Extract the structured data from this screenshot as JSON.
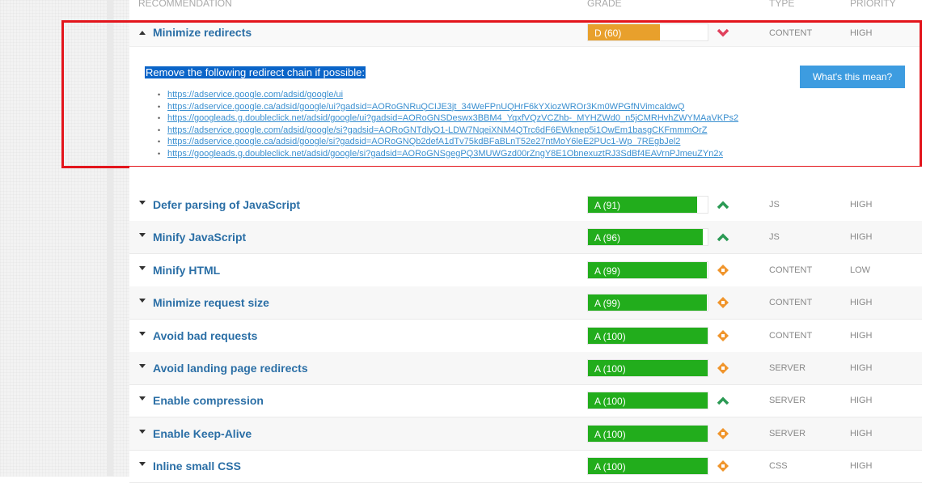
{
  "header": {
    "recommendation": "RECOMMENDATION",
    "grade": "GRADE",
    "type": "TYPE",
    "priority": "PRIORITY"
  },
  "expanded": {
    "name": "Minimize redirects",
    "grade_label": "D (60)",
    "grade_value": 60,
    "grade_color": "#e8a02c",
    "trend_icon": "chevron-down-icon",
    "trend_color": "#e0415c",
    "type": "CONTENT",
    "priority": "HIGH",
    "message": "Remove the following redirect chain if possible:",
    "button": "What's this mean?",
    "urls": [
      "https://adservice.google.com/adsid/google/ui",
      "https://adservice.google.ca/adsid/google/ui?gadsid=AORoGNRuQCIJE3jt_34WeFPnUQHrF6kYXiozWROr3Km0WPGfNVimcaldwQ",
      "https://googleads.g.doubleclick.net/adsid/google/ui?gadsid=AORoGNSDeswx3BBM4_YqxfVQzVCZhb-_MYHZWd0_n5jCMRHvhZWYMAaVKPs2",
      "https://adservice.google.com/adsid/google/si?gadsid=AORoGNTdlyO1-LDW7NqeiXNM4QTrc6dF6EWknep5i1OwEm1basgCKFmmmOrZ",
      "https://adservice.google.ca/adsid/google/si?gadsid=AORoGNQb2defA1dTv75kdBFaBLnT52e27ntMoY6leE2PUc1-Wp_7REgbJel2",
      "https://googleads.g.doubleclick.net/adsid/google/si?gadsid=AORoGNSgegPQ3MUWGzd00rZngY8E1ObnexuztRJ3SdBf4EAVrnPJmeuZYn2x"
    ]
  },
  "rows": [
    {
      "name": "Defer parsing of JavaScript",
      "grade_label": "A (91)",
      "grade_value": 91,
      "trend": "up",
      "type": "JS",
      "priority": "HIGH"
    },
    {
      "name": "Minify JavaScript",
      "grade_label": "A (96)",
      "grade_value": 96,
      "trend": "up",
      "type": "JS",
      "priority": "HIGH"
    },
    {
      "name": "Minify HTML",
      "grade_label": "A (99)",
      "grade_value": 99,
      "trend": "diamond",
      "type": "CONTENT",
      "priority": "LOW"
    },
    {
      "name": "Minimize request size",
      "grade_label": "A (99)",
      "grade_value": 99,
      "trend": "diamond",
      "type": "CONTENT",
      "priority": "HIGH"
    },
    {
      "name": "Avoid bad requests",
      "grade_label": "A (100)",
      "grade_value": 100,
      "trend": "diamond",
      "type": "CONTENT",
      "priority": "HIGH"
    },
    {
      "name": "Avoid landing page redirects",
      "grade_label": "A (100)",
      "grade_value": 100,
      "trend": "diamond",
      "type": "SERVER",
      "priority": "HIGH"
    },
    {
      "name": "Enable compression",
      "grade_label": "A (100)",
      "grade_value": 100,
      "trend": "up",
      "type": "SERVER",
      "priority": "HIGH"
    },
    {
      "name": "Enable Keep-Alive",
      "grade_label": "A (100)",
      "grade_value": 100,
      "trend": "diamond",
      "type": "SERVER",
      "priority": "HIGH"
    },
    {
      "name": "Inline small CSS",
      "grade_label": "A (100)",
      "grade_value": 100,
      "trend": "diamond",
      "type": "CSS",
      "priority": "HIGH"
    }
  ],
  "colors": {
    "grade_a": "#22ad1c",
    "trend_up": "#2b9a54",
    "trend_diamond": "#f0952c",
    "highlight_border": "#e3151c"
  }
}
